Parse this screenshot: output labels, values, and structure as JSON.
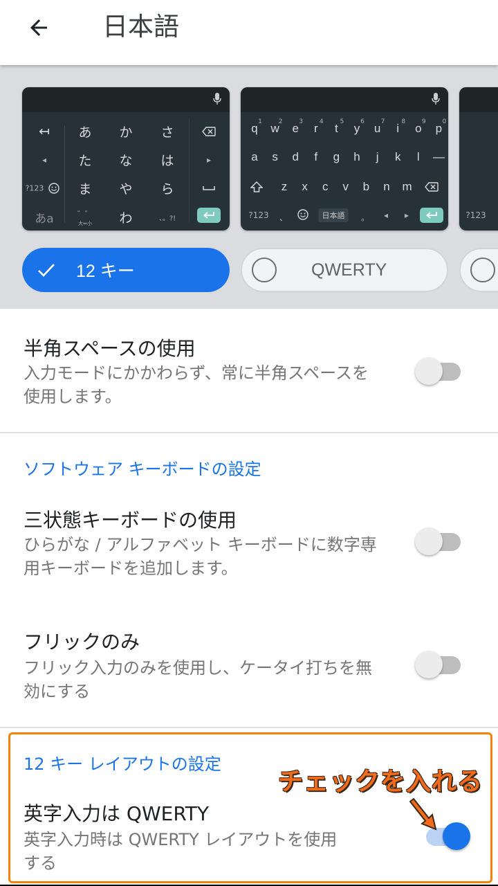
{
  "appbar": {
    "title": "日本語",
    "back_icon": "arrow-back-icon"
  },
  "keyboards": {
    "twelve_key_preview": {
      "left_column": [
        "↤",
        "◂",
        "?123",
        "あa"
      ],
      "grid": [
        [
          "あ",
          "か",
          "さ"
        ],
        [
          "た",
          "な",
          "は"
        ],
        [
          "ま",
          "や",
          "ら"
        ],
        [
          "゛゜",
          "わ",
          "、。?!"
        ]
      ],
      "modifier_sub": "大⇔小",
      "right_column": [
        "delete",
        "▸",
        "space",
        "enter"
      ]
    },
    "qwerty_preview": {
      "row1": [
        "q",
        "w",
        "e",
        "r",
        "t",
        "y",
        "u",
        "i",
        "o",
        "p"
      ],
      "row1_numbers": [
        "1",
        "2",
        "3",
        "4",
        "5",
        "6",
        "7",
        "8",
        "9",
        "0"
      ],
      "row2": [
        "a",
        "s",
        "d",
        "f",
        "g",
        "h",
        "j",
        "k",
        "l",
        "—"
      ],
      "row3": [
        "z",
        "x",
        "c",
        "v",
        "b",
        "n",
        "m"
      ],
      "row4": [
        "?123",
        "、",
        "日本語",
        "。"
      ],
      "lang_key": "日本語"
    },
    "third_preview": {
      "label": "?123"
    },
    "options": [
      {
        "label": "12 キー",
        "selected": true
      },
      {
        "label": "QWERTY",
        "selected": false
      },
      {
        "label": "",
        "selected": false
      }
    ]
  },
  "settings": {
    "half_width_space": {
      "title": "半角スペースの使用",
      "summary": "入力モードにかかわらず、常に半角スペースを使用します。",
      "enabled": false
    },
    "software_keyboard_category": "ソフトウェア キーボードの設定",
    "three_state_keyboard": {
      "title": "三状態キーボードの使用",
      "summary": "ひらがな / アルファベット キーボードに数字専用キーボードを追加します。",
      "enabled": false
    },
    "flick_only": {
      "title": "フリックのみ",
      "summary": "フリック入力のみを使用し、ケータイ打ちを無効にする",
      "enabled": false
    },
    "twelve_key_layout_category": "12 キー レイアウトの設定",
    "qwerty_for_alphabet": {
      "title": "英字入力は QWERTY",
      "summary": "英字入力時は QWERTY レイアウトを使用する",
      "enabled": true
    }
  },
  "annotation": {
    "text": "チェックを入れる",
    "color": "#f26b1d",
    "box_color": "#f5820b"
  },
  "colors": {
    "accent": "#1a73e8",
    "keyboard_bg": "#263238",
    "enter_key": "#7fcbc0"
  }
}
